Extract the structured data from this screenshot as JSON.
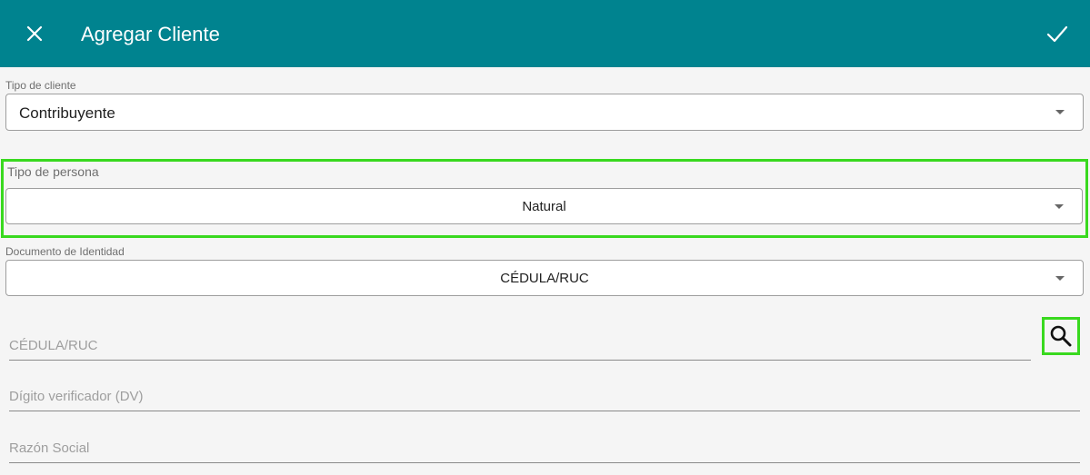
{
  "appbar": {
    "title": "Agregar Cliente",
    "background": "#00838f",
    "close_icon": "close-icon",
    "confirm_icon": "check-icon"
  },
  "tipo_cliente": {
    "label": "Tipo de cliente",
    "value": "Contribuyente"
  },
  "tipo_persona": {
    "label": "Tipo de persona",
    "value": "Natural"
  },
  "documento": {
    "label": "Documento de Identidad",
    "value": "CÉDULA/RUC"
  },
  "fields": {
    "cedula_placeholder": "CÉDULA/RUC",
    "dv_placeholder": "Dígito verificador (DV)",
    "razon_placeholder": "Razón Social"
  },
  "icons": {
    "search": "search-icon",
    "dropdown": "caret-down-icon"
  },
  "highlight_color": "#39d91f"
}
